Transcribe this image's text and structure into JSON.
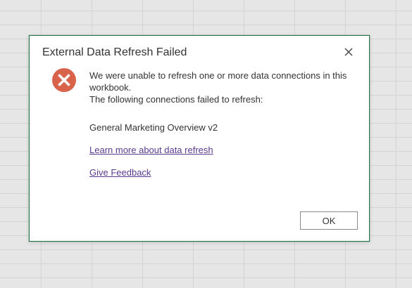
{
  "dialog": {
    "title": "External Data Refresh Failed",
    "close_icon": "close-icon",
    "error_icon": "error-circle-x-icon",
    "message_line1": "We were unable to refresh one or more data connections in this workbook.",
    "message_line2": "The following connections failed to refresh:",
    "connection_name": "General Marketing Overview v2",
    "learn_more_link": "Learn more about data refresh",
    "feedback_link": "Give Feedback",
    "ok_label": "OK"
  },
  "colors": {
    "dialog_border": "#217346",
    "error_icon": "#d9634a",
    "link": "#5a3a8e"
  }
}
